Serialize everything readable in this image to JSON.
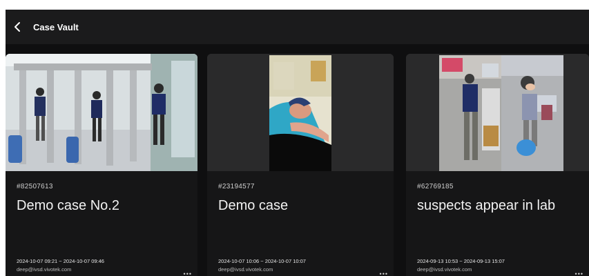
{
  "header": {
    "title": "Case Vault"
  },
  "cards": [
    {
      "id": "#82507613",
      "name": "Demo case No.2",
      "range": "2024-10-07 09:21 ~ 2024-10-07 09:46",
      "email": "deep@ivsd.vivotek.com"
    },
    {
      "id": "#23194577",
      "name": "Demo case",
      "range": "2024-10-07 10:06 ~ 2024-10-07 10:07",
      "email": "deep@ivsd.vivotek.com"
    },
    {
      "id": "#62769185",
      "name": "suspects appear in lab",
      "range": "2024-09-13 10:53 ~ 2024-09-13 15:07",
      "email": "deep@ivsd.vivotek.com"
    }
  ],
  "icons": {
    "back": "chevron-left-icon",
    "more": "more-horizontal-icon"
  }
}
